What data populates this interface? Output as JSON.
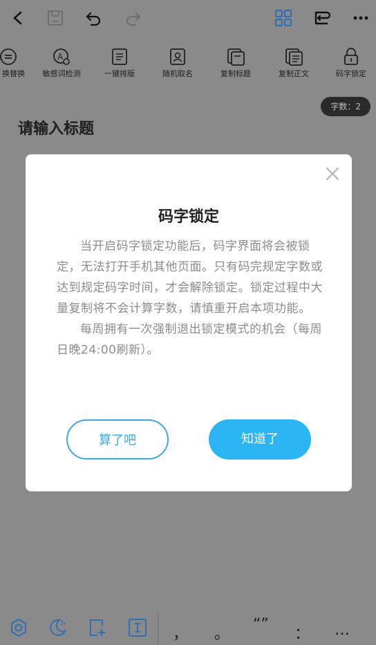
{
  "toolbar": {
    "back_icon": "chevron-left-icon",
    "save_icon": "save-icon",
    "undo_icon": "undo-icon",
    "redo_icon": "redo-icon",
    "grid_icon": "grid-icon",
    "switch_icon": "switch-icon",
    "more_icon": "more-icon"
  },
  "tools": [
    {
      "label": "换替换",
      "icon": "replace-icon"
    },
    {
      "label": "敏感词检测",
      "icon": "sensitive-check-icon"
    },
    {
      "label": "一键排版",
      "icon": "format-icon"
    },
    {
      "label": "随机取名",
      "icon": "random-name-icon"
    },
    {
      "label": "复制标题",
      "icon": "copy-title-icon"
    },
    {
      "label": "复制正文",
      "icon": "copy-body-icon"
    },
    {
      "label": "码字锁定",
      "icon": "lock-icon"
    }
  ],
  "editor": {
    "word_count": "字数：2",
    "title_placeholder": "请输入标题"
  },
  "dialog": {
    "title": "码字锁定",
    "paragraph1": "当开启码字锁定功能后，码字界面将会被锁定，无法打开手机其他页面。只有码完规定字数或达到规定码字时间，才会解除锁定。锁定过程中大量复制将不会计算字数，请慎重开启本项功能。",
    "paragraph2": "每周拥有一次强制退出锁定模式的机会（每周日晚24:00刷新）。",
    "cancel_label": "算了吧",
    "confirm_label": "知道了"
  },
  "bottom": {
    "punct_comma": "，",
    "punct_period": "。",
    "punct_quote": "“”",
    "punct_colon": "：",
    "punct_ellipsis": "…"
  },
  "colors": {
    "overlay": "#8a8a8a",
    "accent": "#2bb5f4",
    "toolbar_blue": "#3a7bc8"
  }
}
